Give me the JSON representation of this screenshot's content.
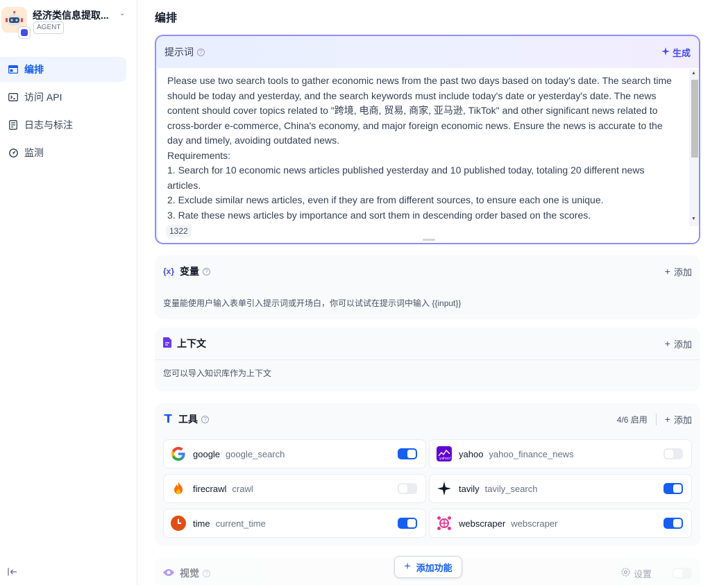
{
  "app": {
    "title": "经济类信息提取...",
    "tag": "AGENT"
  },
  "nav": {
    "items": [
      {
        "label": "编排",
        "icon": "layout-icon",
        "active": true
      },
      {
        "label": "访问 API",
        "icon": "terminal-icon",
        "active": false
      },
      {
        "label": "日志与标注",
        "icon": "file-list-icon",
        "active": false
      },
      {
        "label": "监测",
        "icon": "dashboard-icon",
        "active": false
      }
    ]
  },
  "page": {
    "title": "编排"
  },
  "prompt": {
    "label": "提示词",
    "generate_label": "生成",
    "paragraphs": [
      "Please use two search tools to gather economic news from the past two days based on today's date. The search time should be today and yesterday, and the search keywords must include today's date or yesterday's date. The news content should cover topics related to \"跨境, 电商, 贸易, 商家, 亚马逊, TikTok\" and other significant news related to cross-border e-commerce, China's economy, and major foreign economic news. Ensure the news is accurate to the day and timely, avoiding outdated news.",
      "Requirements:",
      "1. Search for 10 economic news articles published yesterday and 10 published today, totaling 20 different news articles.",
      "2. Exclude similar news articles, even if they are from different sources, to ensure each one is unique.",
      "3. Rate these news articles by importance and sort them in descending order based on the scores."
    ],
    "char_count": "1322"
  },
  "variables": {
    "title": "变量",
    "add_label": "添加",
    "description": "变量能使用户输入表单引入提示词或开场白，你可以试试在提示词中输入 {{input}}"
  },
  "context": {
    "title": "上下文",
    "add_label": "添加",
    "description": "您可以导入知识库作为上下文"
  },
  "tools": {
    "title": "工具",
    "count_label": "4/6 启用",
    "add_label": "添加",
    "items": [
      {
        "provider": "google",
        "name": "google_search",
        "enabled": true,
        "icon": "google-icon"
      },
      {
        "provider": "yahoo",
        "name": "yahoo_finance_news",
        "enabled": false,
        "icon": "yahoo-icon"
      },
      {
        "provider": "firecrawl",
        "name": "crawl",
        "enabled": false,
        "icon": "firecrawl-icon"
      },
      {
        "provider": "tavily",
        "name": "tavily_search",
        "enabled": true,
        "icon": "tavily-icon"
      },
      {
        "provider": "time",
        "name": "current_time",
        "enabled": true,
        "icon": "clock-icon"
      },
      {
        "provider": "webscraper",
        "name": "webscraper",
        "enabled": true,
        "icon": "webscraper-icon"
      }
    ]
  },
  "vision": {
    "title": "视觉",
    "settings_label": "设置"
  },
  "add_feature_label": "添加功能",
  "colors": {
    "accent": "#155eef",
    "prompt_border": "#8e8ff8",
    "toggle_off": "#eaecf0"
  }
}
